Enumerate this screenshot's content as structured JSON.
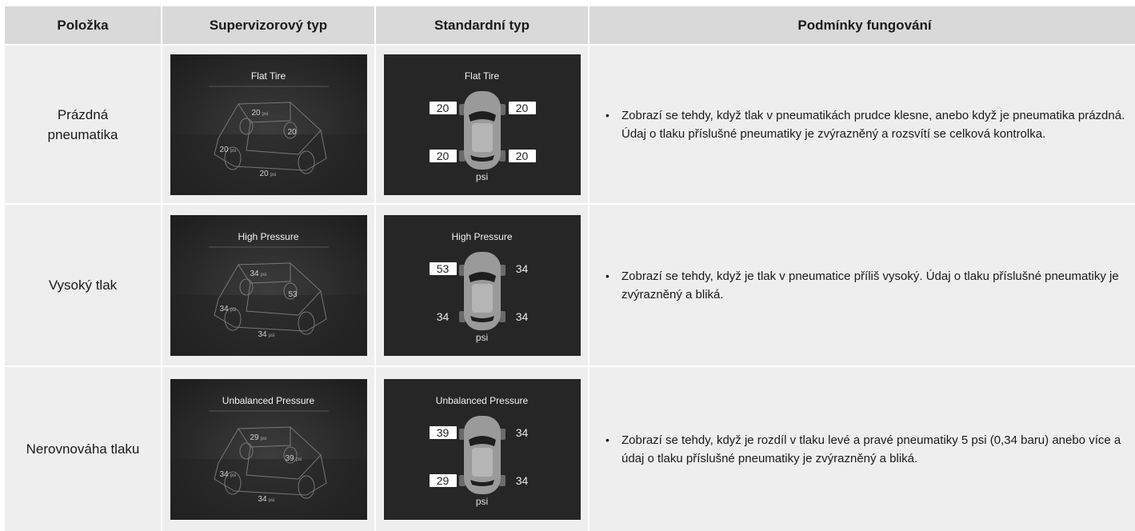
{
  "table": {
    "headers": [
      "Položka",
      "Supervizorový typ",
      "Standardní typ",
      "Podmínky fungování"
    ],
    "rows": [
      {
        "item": "Prázdná pneumatika",
        "supervisor": {
          "title": "Flat Tire",
          "values": [
            "20",
            "20",
            "20",
            "20"
          ],
          "unit": "psi"
        },
        "standard": {
          "title": "Flat Tire",
          "fl": "20",
          "fr": "20",
          "rl": "20",
          "rr": "20",
          "unit": "psi",
          "highlighted": [
            "fl",
            "fr",
            "rl",
            "rr"
          ]
        },
        "description": "Zobrazí se tehdy, když tlak v pneumatikách prudce klesne, anebo když je pneumatika prázdná. Údaj o tlaku příslušné pneumatiky je zvýrazněný a rozsvítí se celková kontrolka."
      },
      {
        "item": "Vysoký tlak",
        "supervisor": {
          "title": "High Pressure",
          "values": [
            "34",
            "53",
            "34",
            "34"
          ],
          "unit": "psi"
        },
        "standard": {
          "title": "High Pressure",
          "fl": "53",
          "fr": "34",
          "rl": "34",
          "rr": "34",
          "unit": "psi",
          "highlighted": [
            "fl"
          ]
        },
        "description": "Zobrazí se tehdy, když je tlak v pneumatice příliš vysoký. Údaj o tlaku příslušné pneumatiky je zvýrazněný a bliká."
      },
      {
        "item": "Nerovnováha tlaku",
        "supervisor": {
          "title": "Unbalanced Pressure",
          "values": [
            "29",
            "39",
            "34",
            "34"
          ],
          "unit": "psi"
        },
        "standard": {
          "title": "Unbalanced Pressure",
          "fl": "39",
          "fr": "34",
          "rl": "29",
          "rr": "34",
          "unit": "psi",
          "highlighted": [
            "fl",
            "rl"
          ]
        },
        "description": "Zobrazí se tehdy, když je rozdíl v tlaku levé a pravé pneumatiky 5 psi (0,34 baru) anebo více a údaj o tlaku příslušné pneumatiky je zvýrazněný a bliká."
      }
    ]
  },
  "colors": {
    "header_bg": "#d9d9d9",
    "cell_bg": "#eeeeee",
    "screen_bg": "#262626",
    "highlight_box": "#ffffff"
  },
  "icons": {
    "bullet": "bullet-point",
    "car_top": "car-top-view-icon",
    "car_3d": "car-3d-wireframe-icon"
  }
}
